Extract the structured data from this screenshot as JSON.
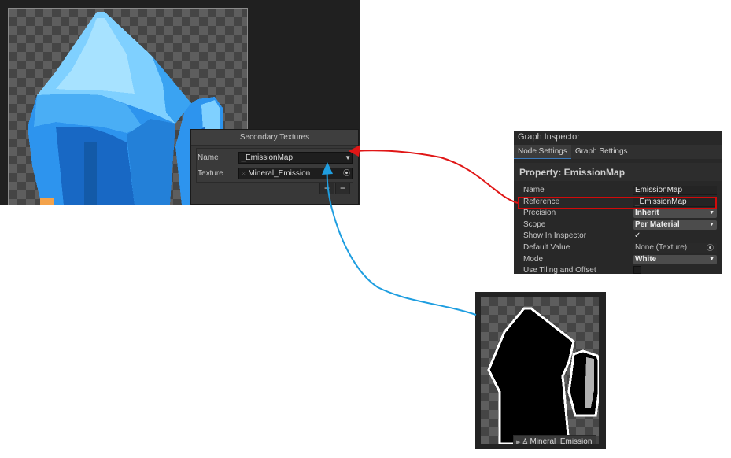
{
  "secondary_textures": {
    "title": "Secondary Textures",
    "name_label": "Name",
    "name_value": "_EmissionMap",
    "texture_label": "Texture",
    "texture_value": "Mineral_Emission",
    "add_label": "+",
    "remove_label": "−"
  },
  "graph_inspector": {
    "title": "Graph Inspector",
    "tabs": [
      {
        "label": "Node Settings",
        "active": true
      },
      {
        "label": "Graph Settings",
        "active": false
      }
    ],
    "property_title": "Property: EmissionMap",
    "rows": {
      "name": {
        "label": "Name",
        "value": "EmissionMap"
      },
      "reference": {
        "label": "Reference",
        "value": "_EmissionMap"
      },
      "precision": {
        "label": "Precision",
        "value": "Inherit"
      },
      "scope": {
        "label": "Scope",
        "value": "Per Material"
      },
      "show_in_inspector": {
        "label": "Show In Inspector",
        "value": "✓"
      },
      "default_value": {
        "label": "Default Value",
        "value": "None (Texture)"
      },
      "mode": {
        "label": "Mode",
        "value": "White"
      },
      "use_tiling": {
        "label": "Use Tiling and Offset"
      }
    }
  },
  "emission_preview": {
    "label": "Mineral_Emission"
  },
  "colors": {
    "arrow_red": "#e01616",
    "arrow_blue": "#1f9ee0",
    "highlight_red": "#d20a0a",
    "crystal_light": "#7fd0ff",
    "crystal_mid": "#2d94ee",
    "crystal_dark": "#1868c4"
  }
}
